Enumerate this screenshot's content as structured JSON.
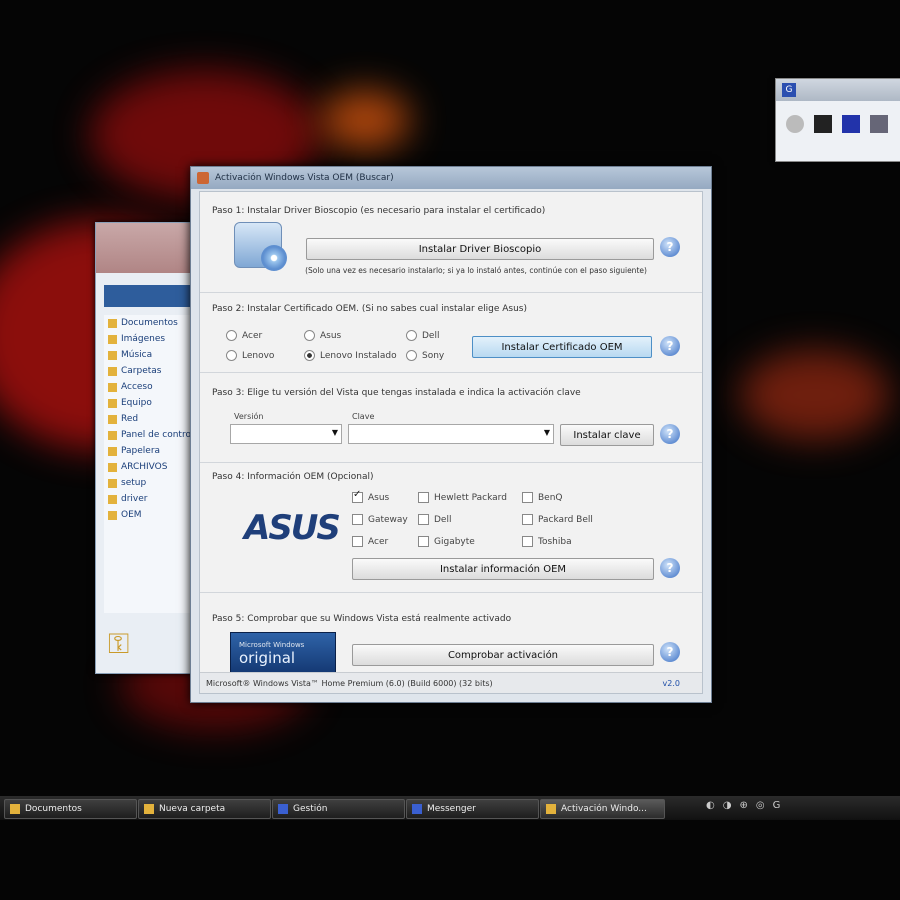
{
  "window": {
    "title": "Activación Windows Vista OEM (Buscar)",
    "step1_text": "Paso 1: Instalar Driver Bioscopio (es necesario para instalar el certificado)",
    "install_driver_button": "Instalar Driver Bioscopio",
    "step1_note": "(Solo una vez es necesario instalarlo; si ya lo instaló antes, continúe con el paso siguiente)",
    "step2_text": "Paso 2: Instalar Certificado OEM. (Si no sabes cual instalar elige Asus)",
    "step2_options": [
      "Acer",
      "Asus",
      "Dell",
      "Lenovo",
      "Lenovo Instalado",
      "Sony"
    ],
    "install_certificate_button": "Instalar Certificado OEM",
    "step3_text": "Paso 3: Elige tu versión del Vista que tengas instalada e indica la activación clave",
    "combo_version_caption": "Versión",
    "combo_key_caption": "Clave",
    "install_key_button": "Instalar clave",
    "step4_text": "Paso 4: Información OEM (Opcional)",
    "oem_brands": [
      "Asus",
      "Hewlett Packard",
      "BenQ",
      "Gateway",
      "Dell",
      "Packard Bell",
      "Acer",
      "Gigabyte",
      "Toshiba"
    ],
    "oem_info_button": "Instalar información OEM",
    "step5_text": "Paso 5: Comprobar que su Windows Vista está realmente activado",
    "check_activation_button": "Comprobar activación",
    "help_glyph": "?",
    "asus_logo_text": "ASUS",
    "genuine_line1": "Microsoft Windows",
    "genuine_line2": "original",
    "statusbar_text": "Microsoft® Windows Vista™ Home Premium (6.0) (Build 6000) (32 bits)",
    "version": "v2.0"
  },
  "gadget": {
    "icon_label": "G"
  },
  "explorer": {
    "items": [
      "Documentos",
      "Imágenes",
      "Música",
      "Carpetas",
      "Acceso",
      "Equipo",
      "Red",
      "Panel de control",
      "Papelera",
      "ARCHIVOS",
      "setup",
      "driver",
      "OEM"
    ]
  },
  "taskbar": {
    "items": [
      "Documentos",
      "Nueva carpeta",
      "Gestión",
      "Messenger",
      "Activación Windo..."
    ],
    "tray_glyphs": [
      "◐",
      "◑",
      "⊕",
      "◎",
      "G"
    ]
  }
}
